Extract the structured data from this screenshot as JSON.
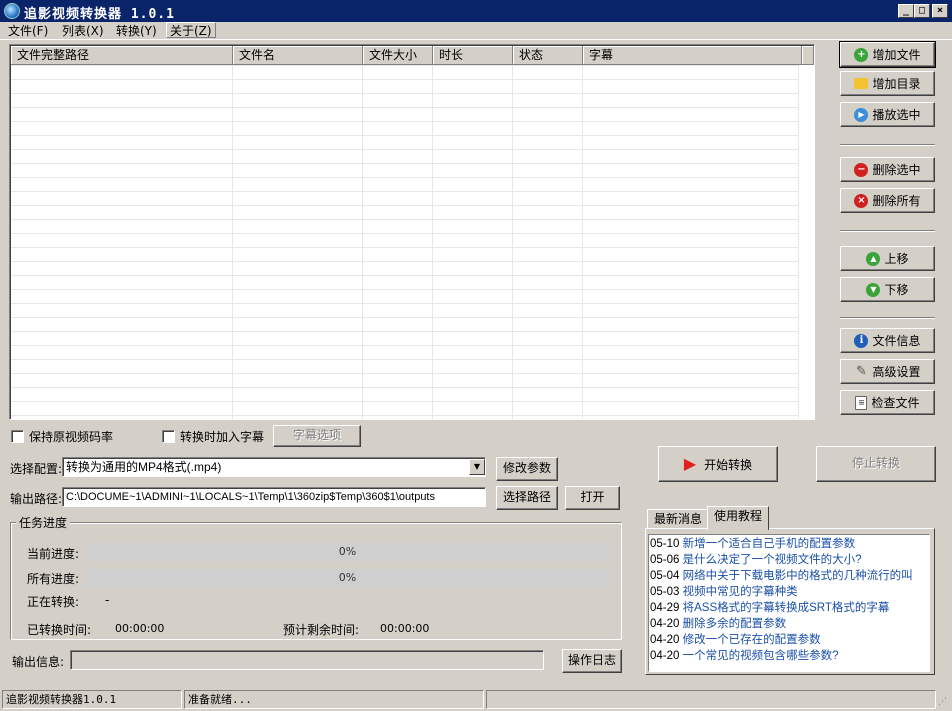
{
  "window": {
    "title": "追影视频转换器 1.0.1",
    "controls": {
      "minimize": "_",
      "maximize": "□",
      "close": "×"
    }
  },
  "menu": [
    {
      "label": "文件(F)"
    },
    {
      "label": "列表(X)"
    },
    {
      "label": "转换(Y)"
    },
    {
      "label": "关于(Z)"
    }
  ],
  "file_list": {
    "columns": [
      "文件完整路径",
      "文件名",
      "文件大小",
      "时长",
      "状态",
      "字幕"
    ],
    "rows": []
  },
  "side_buttons": {
    "add_file": "增加文件",
    "add_folder": "增加目录",
    "play_selected": "播放选中",
    "delete_selected": "删除选中",
    "delete_all": "删除所有",
    "move_up": "上移",
    "move_down": "下移",
    "file_info": "文件信息",
    "advanced": "高级设置",
    "check_file": "检查文件"
  },
  "options": {
    "keep_bitrate_label": "保持原视频码率",
    "keep_bitrate_checked": false,
    "add_subtitle_label": "转换时加入字幕",
    "add_subtitle_checked": false,
    "subtitle_options_button": "字幕选项"
  },
  "config": {
    "label": "选择配置:",
    "selected": "转换为通用的MP4格式(.mp4)",
    "modify_button": "修改参数"
  },
  "output": {
    "label": "输出路径:",
    "path": "C:\\DOCUME~1\\ADMINI~1\\LOCALS~1\\Temp\\1\\360zip$Temp\\360$1\\outputs",
    "choose_button": "选择路径",
    "open_button": "打开"
  },
  "actions": {
    "start": "开始转换",
    "stop": "停止转换"
  },
  "progress": {
    "group_title": "任务进度",
    "current_label": "当前进度:",
    "current_value": "0%",
    "current_fraction": 0,
    "all_label": "所有进度:",
    "all_value": "0%",
    "all_fraction": 0,
    "converting_label": "正在转换:",
    "converting_value": "-",
    "elapsed_label": "已转换时间:",
    "elapsed_value": "00:00:00",
    "remaining_label": "预计剩余时间:",
    "remaining_value": "00:00:00"
  },
  "log": {
    "label": "输出信息:",
    "value": "",
    "button": "操作日志"
  },
  "news": {
    "tabs": [
      "最新消息",
      "使用教程"
    ],
    "active_tab": "使用教程",
    "items": [
      {
        "date": "05-10",
        "title": "新增一个适合自己手机的配置参数"
      },
      {
        "date": "05-06",
        "title": "是什么决定了一个视频文件的大小?"
      },
      {
        "date": "05-04",
        "title": "网络中关于下载电影中的格式的几种流行的叫"
      },
      {
        "date": "05-03",
        "title": "视频中常见的字幕种类"
      },
      {
        "date": "04-29",
        "title": "将ASS格式的字幕转换成SRT格式的字幕"
      },
      {
        "date": "04-20",
        "title": "删除多余的配置参数"
      },
      {
        "date": "04-20",
        "title": "修改一个已存在的配置参数"
      },
      {
        "date": "04-20",
        "title": "一个常见的视频包含哪些参数?"
      }
    ]
  },
  "status_bar": {
    "app": "追影视频转换器1.0.1",
    "message": "准备就绪...",
    "extra": ""
  },
  "colors": {
    "title_bar": "#0a246a",
    "face": "#d4d0c8",
    "link": "#1a4fa8",
    "start_icon": "#e02020"
  }
}
